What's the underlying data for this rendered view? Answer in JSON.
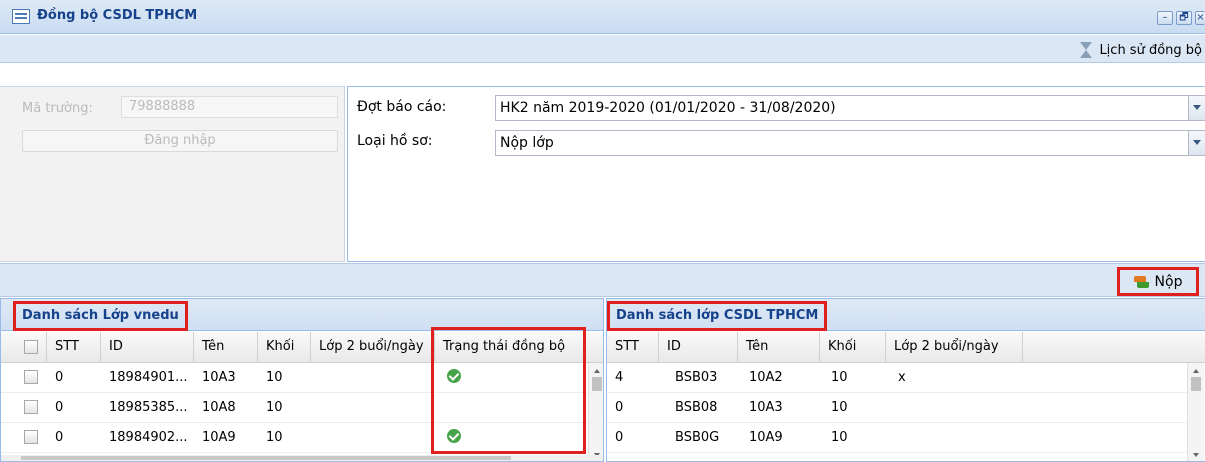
{
  "window": {
    "title": "Đồng bộ CSDL TPHCM",
    "buttons": {
      "minimize": "–",
      "restore": "🗗",
      "close": "×"
    }
  },
  "toolbar": {
    "history_label": "Lịch sử đồng bộ",
    "history_icon": "hourglass-icon",
    "submit_label": "Nộp",
    "submit_icon": "sync-icon"
  },
  "login": {
    "school_code_label": "Mã trường:",
    "school_code_value": "79888888",
    "login_button": "Đăng nhập"
  },
  "filters": {
    "report_period_label": "Đợt báo cáo:",
    "report_period_value": "HK2 năm 2019-2020 (01/01/2020 - 31/08/2020)",
    "record_type_label": "Loại hồ sơ:",
    "record_type_value": "Nộp lớp"
  },
  "left_grid": {
    "title": "Danh sách Lớp vnedu",
    "columns": {
      "stt": "STT",
      "id": "ID",
      "name": "Tên",
      "grade": "Khối",
      "two_sessions": "Lớp 2 buổi/ngày",
      "sync_status": "Trạng thái đồng bộ"
    },
    "rows": [
      {
        "stt": "0",
        "id": "18984901...",
        "name": "10A3",
        "grade": "10",
        "two_sessions": "",
        "synced": true
      },
      {
        "stt": "0",
        "id": "18985385...",
        "name": "10A8",
        "grade": "10",
        "two_sessions": "",
        "synced": false
      },
      {
        "stt": "0",
        "id": "18984902...",
        "name": "10A9",
        "grade": "10",
        "two_sessions": "",
        "synced": true
      }
    ]
  },
  "right_grid": {
    "title": "Danh sách lớp CSDL TPHCM",
    "columns": {
      "stt": "STT",
      "id": "ID",
      "name": "Tên",
      "grade": "Khối",
      "two_sessions": "Lớp 2 buổi/ngày"
    },
    "rows": [
      {
        "stt": "4",
        "id": "BSB03",
        "name": "10A2",
        "grade": "10",
        "two_sessions": "x"
      },
      {
        "stt": "0",
        "id": "BSB08",
        "name": "10A3",
        "grade": "10",
        "two_sessions": ""
      },
      {
        "stt": "0",
        "id": "BSB0G",
        "name": "10A9",
        "grade": "10",
        "two_sessions": ""
      }
    ]
  },
  "colors": {
    "highlight": "#e0201f",
    "title_text": "#15428b",
    "panel_bg": "#dce7f5",
    "ok": "#47a34a"
  }
}
